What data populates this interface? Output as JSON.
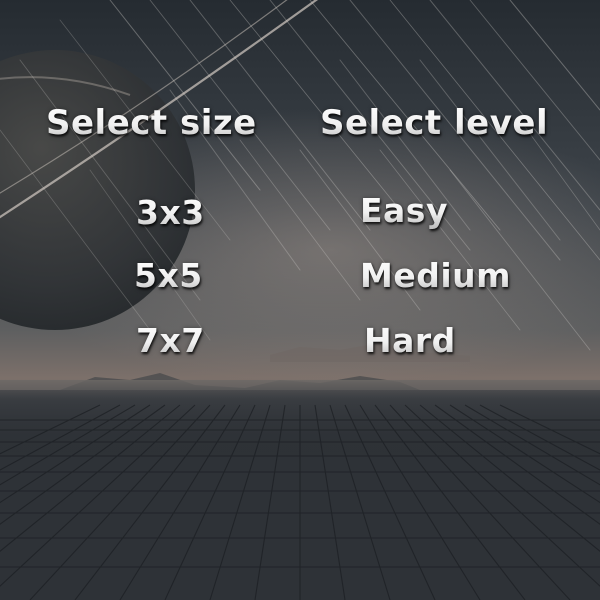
{
  "menu": {
    "size": {
      "heading": "Select size",
      "options": [
        "3x3",
        "5x5",
        "7x7"
      ]
    },
    "level": {
      "heading": "Select level",
      "options": [
        "Easy",
        "Medium",
        "Hard"
      ]
    }
  },
  "colors": {
    "sky_top": "#2b3138",
    "sky_mid": "#5b5e61",
    "horizon": "#7a6d66",
    "floor": "#2c3036",
    "text": "#ffffff"
  }
}
